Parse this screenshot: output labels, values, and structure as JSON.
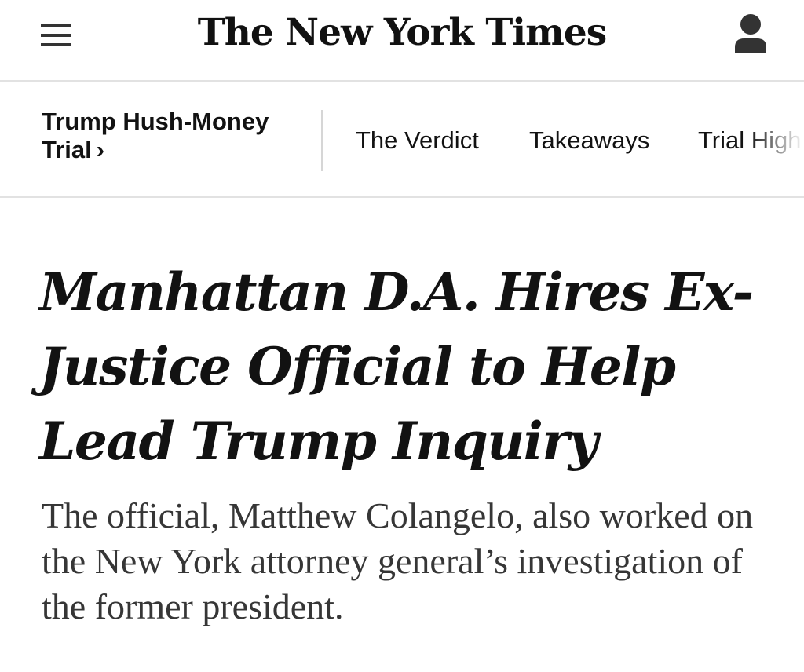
{
  "masthead": {
    "menu_icon": "hamburger-menu-icon",
    "logo_text": "The New York Times",
    "account_icon": "user-account-icon"
  },
  "section_nav": {
    "title_line1": "Trump Hush-Money",
    "title_line2": "Trial",
    "title_chevron": "›",
    "links": [
      {
        "label": "The Verdict"
      },
      {
        "label": "Takeaways"
      },
      {
        "label": "Trial High"
      }
    ]
  },
  "article": {
    "headline": "Manhattan D.A. Hires Ex-Justice Official to Help Lead Trump Inquiry",
    "summary": "The official, Matthew Colangelo, also worked on the New York attorney general’s investigation of the former president."
  },
  "colors": {
    "text": "#121212",
    "summary_text": "#363636",
    "divider": "#e2e2e2",
    "background": "#ffffff"
  }
}
